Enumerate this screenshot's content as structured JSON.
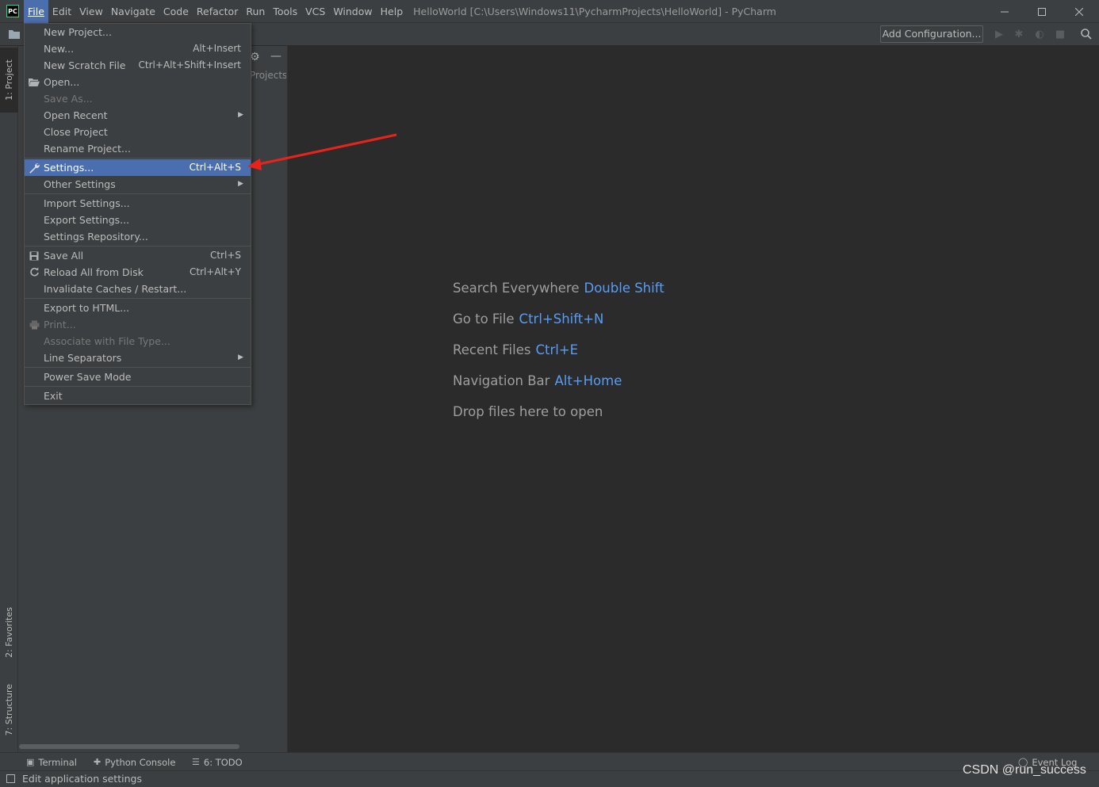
{
  "app": {
    "logo_text": "PC",
    "window_title": "HelloWorld [C:\\Users\\Windows11\\PycharmProjects\\HelloWorld] - PyCharm"
  },
  "menubar": {
    "items": [
      "File",
      "Edit",
      "View",
      "Navigate",
      "Code",
      "Refactor",
      "Run",
      "Tools",
      "VCS",
      "Window",
      "Help"
    ]
  },
  "toolbar": {
    "add_configuration": "Add Configuration..."
  },
  "tool_windows": {
    "project": "1: Project",
    "favorites": "2: Favorites",
    "structure": "7: Structure"
  },
  "project_panel": {
    "crumb": "Projects'"
  },
  "file_menu": {
    "new_project": "New Project...",
    "new": "New...",
    "new_shortcut": "Alt+Insert",
    "new_scratch": "New Scratch File",
    "new_scratch_shortcut": "Ctrl+Alt+Shift+Insert",
    "open": "Open...",
    "save_as": "Save As...",
    "open_recent": "Open Recent",
    "close_project": "Close Project",
    "rename_project": "Rename Project...",
    "settings": "Settings...",
    "settings_shortcut": "Ctrl+Alt+S",
    "other_settings": "Other Settings",
    "import_settings": "Import Settings...",
    "export_settings": "Export Settings...",
    "settings_repository": "Settings Repository...",
    "save_all": "Save All",
    "save_all_shortcut": "Ctrl+S",
    "reload_all": "Reload All from Disk",
    "reload_all_shortcut": "Ctrl+Alt+Y",
    "invalidate_caches": "Invalidate Caches / Restart...",
    "export_html": "Export to HTML...",
    "print": "Print...",
    "associate_file_type": "Associate with File Type...",
    "line_separators": "Line Separators",
    "power_save_mode": "Power Save Mode",
    "exit": "Exit"
  },
  "welcome": {
    "search_label": "Search Everywhere",
    "search_key": "Double Shift",
    "goto_label": "Go to File",
    "goto_key": "Ctrl+Shift+N",
    "recent_label": "Recent Files",
    "recent_key": "Ctrl+E",
    "navbar_label": "Navigation Bar",
    "navbar_key": "Alt+Home",
    "drop_label": "Drop files here to open"
  },
  "bottom_tabs": {
    "terminal": "Terminal",
    "python_console": "Python Console",
    "todo": "6: TODO",
    "event_log": "Event Log"
  },
  "status": {
    "text": "Edit application settings"
  },
  "watermark": "CSDN @run_success",
  "colors": {
    "accent": "#4b6eaf",
    "shortcut_blue": "#589df6",
    "annotation_red": "#e8231c"
  }
}
